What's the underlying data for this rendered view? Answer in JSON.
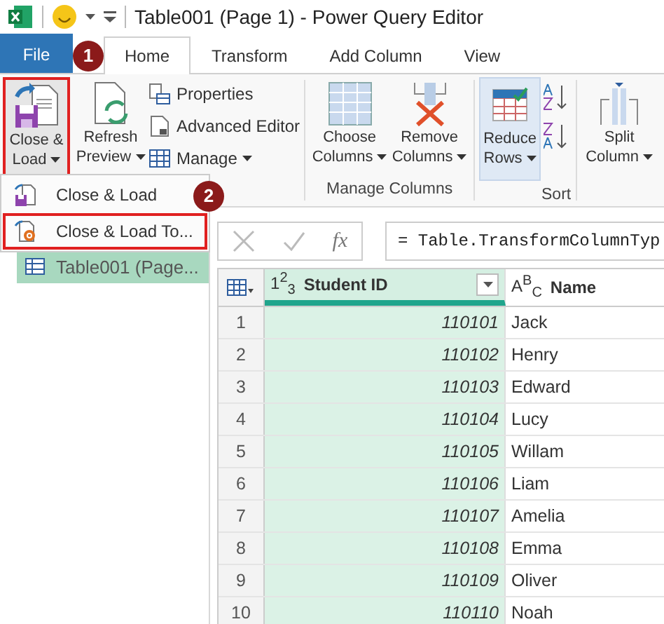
{
  "title_bar": {
    "title": "Table001 (Page 1) - Power Query Editor"
  },
  "tabs": [
    {
      "label": "File",
      "kind": "file",
      "selected": false
    },
    {
      "label": "Home",
      "kind": "tab",
      "selected": true
    },
    {
      "label": "Transform",
      "kind": "tab",
      "selected": false
    },
    {
      "label": "Add Column",
      "kind": "tab",
      "selected": false
    },
    {
      "label": "View",
      "kind": "tab",
      "selected": false
    }
  ],
  "ribbon": {
    "close_load": {
      "label": "Close & Load",
      "dropdown": true,
      "highlighted": true
    },
    "refresh_preview": {
      "label": "Refresh Preview",
      "dropdown": true
    },
    "query_items": [
      {
        "label": "Properties",
        "dropdown": false
      },
      {
        "label": "Advanced Editor",
        "dropdown": false
      },
      {
        "label": "Manage",
        "dropdown": true
      }
    ],
    "choose_columns": {
      "label": "Choose Columns",
      "dropdown": true
    },
    "remove_columns": {
      "label": "Remove Columns",
      "dropdown": true
    },
    "manage_columns_label": "Manage Columns",
    "reduce_rows": {
      "label": "Reduce Rows",
      "dropdown": true,
      "selected": true
    },
    "sort_label": "Sort",
    "split_column": {
      "label": "Split Column",
      "dropdown": true
    }
  },
  "callouts": [
    {
      "label": "1"
    },
    {
      "label": "2"
    }
  ],
  "menu": {
    "items": [
      {
        "label": "Close & Load",
        "highlighted": false
      },
      {
        "label": "Close & Load To...",
        "highlighted": true
      }
    ]
  },
  "queries": [
    {
      "label": "Table001 (Page...",
      "selected": true
    }
  ],
  "formula_bar": {
    "fx": "fx",
    "formula": "= Table.TransformColumnTyp"
  },
  "table": {
    "columns": [
      {
        "type": "1$^{2}$$_{3}$",
        "label": "Student ID",
        "filter": true,
        "selected": true
      },
      {
        "type": "A$^{B}$$_{C}$",
        "label": "Name",
        "filter": false,
        "selected": false
      }
    ],
    "rows": [
      {
        "index": "1",
        "student_id": "110101",
        "name": "Jack"
      },
      {
        "index": "2",
        "student_id": "110102",
        "name": "Henry"
      },
      {
        "index": "3",
        "student_id": "110103",
        "name": "Edward"
      },
      {
        "index": "4",
        "student_id": "110104",
        "name": "Lucy"
      },
      {
        "index": "5",
        "student_id": "110105",
        "name": "Willam"
      },
      {
        "index": "6",
        "student_id": "110106",
        "name": "Liam"
      },
      {
        "index": "7",
        "student_id": "110107",
        "name": "Amelia"
      },
      {
        "index": "8",
        "student_id": "110108",
        "name": "Emma"
      },
      {
        "index": "9",
        "student_id": "110109",
        "name": "Oliver"
      },
      {
        "index": "10",
        "student_id": "110110",
        "name": "Noah"
      }
    ]
  }
}
